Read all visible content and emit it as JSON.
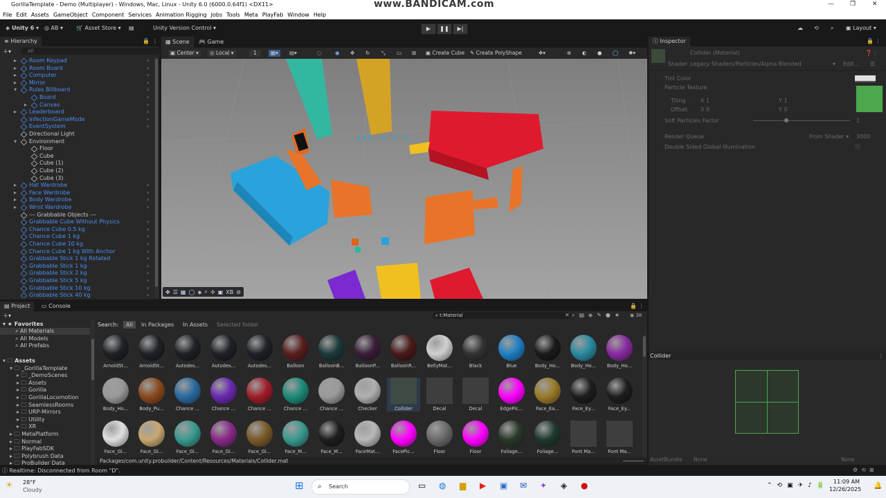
{
  "window": {
    "title": "GorillaTemplate - Demo (Multiplayer) - Windows, Mac, Linux - Unity 6.0 (6000.0.64f1) <DX11>",
    "watermark": "www.BANDICAM.com"
  },
  "menu": [
    "File",
    "Edit",
    "Assets",
    "GameObject",
    "Component",
    "Services",
    "Animation Rigging",
    "Jobs",
    "Tools",
    "Meta",
    "PlayFab",
    "Window",
    "Help"
  ],
  "toolbar": {
    "unity": "Unity 6",
    "account": "AB",
    "asset_store": "Asset Store",
    "version_control": "Unity Version Control",
    "layout": "Layout"
  },
  "hierarchy": {
    "tab": "Hierarchy",
    "search_placeholder": "All",
    "items": [
      {
        "label": "Room Keypad",
        "depth": 1,
        "color": "#4c8ef0"
      },
      {
        "label": "Room Board",
        "depth": 1,
        "color": "#4c8ef0"
      },
      {
        "label": "Computer",
        "depth": 1,
        "color": "#4c8ef0"
      },
      {
        "label": "Mirror",
        "depth": 1,
        "color": "#4c8ef0"
      },
      {
        "label": "Rules Billboard",
        "depth": 1,
        "color": "#4c8ef0"
      },
      {
        "label": "Board",
        "depth": 2,
        "color": "#4c8ef0"
      },
      {
        "label": "Canvas",
        "depth": 2,
        "color": "#4c8ef0"
      },
      {
        "label": "Leaderboard",
        "depth": 1,
        "color": "#4c8ef0"
      },
      {
        "label": "InfectionGameMode",
        "depth": 1,
        "color": "#4c8ef0"
      },
      {
        "label": "EventSystem",
        "depth": 1,
        "color": "#4c8ef0"
      },
      {
        "label": "Directional Light",
        "depth": 1,
        "color": "#c8c8c8"
      },
      {
        "label": "Environment",
        "depth": 1,
        "color": "#c8c8c8"
      },
      {
        "label": "Floor",
        "depth": 2,
        "color": "#c8c8c8"
      },
      {
        "label": "Cube",
        "depth": 2,
        "color": "#c8c8c8"
      },
      {
        "label": "Cube (1)",
        "depth": 2,
        "color": "#c8c8c8"
      },
      {
        "label": "Cube (2)",
        "depth": 2,
        "color": "#c8c8c8"
      },
      {
        "label": "Cube (3)",
        "depth": 2,
        "color": "#c8c8c8"
      },
      {
        "label": "Hat Wardrobe",
        "depth": 1,
        "color": "#4c8ef0"
      },
      {
        "label": "Face Wardrobe",
        "depth": 1,
        "color": "#4c8ef0"
      },
      {
        "label": "Body Wardrobe",
        "depth": 1,
        "color": "#4c8ef0"
      },
      {
        "label": "Wrist Wardrobe",
        "depth": 1,
        "color": "#4c8ef0"
      },
      {
        "label": "--- Grabbable Objects ---",
        "depth": 1,
        "color": "#c8c8c8"
      },
      {
        "label": "Grabbable Cube Without Physics",
        "depth": 1,
        "color": "#4c8ef0"
      },
      {
        "label": "Chance Cube 0.5 kg",
        "depth": 1,
        "color": "#4c8ef0"
      },
      {
        "label": "Chance Cube 1 kg",
        "depth": 1,
        "color": "#4c8ef0"
      },
      {
        "label": "Chance Cube 10 kg",
        "depth": 1,
        "color": "#4c8ef0"
      },
      {
        "label": "Chance Cube 1 kg With Anchor",
        "depth": 1,
        "color": "#4c8ef0"
      },
      {
        "label": "Grabbable Stick 1 kg Rotated",
        "depth": 1,
        "color": "#4c8ef0"
      },
      {
        "label": "Grabbable Stick 1 kg",
        "depth": 1,
        "color": "#4c8ef0"
      },
      {
        "label": "Grabbable Stick 2 kg",
        "depth": 1,
        "color": "#4c8ef0"
      },
      {
        "label": "Grabbable Stick 5 kg",
        "depth": 1,
        "color": "#4c8ef0"
      },
      {
        "label": "Grabbable Stick 10 kg",
        "depth": 1,
        "color": "#4c8ef0"
      },
      {
        "label": "Grabbable Stick 40 kg",
        "depth": 1,
        "color": "#4c8ef0"
      }
    ]
  },
  "scene": {
    "tabs": [
      "Scene",
      "Game"
    ],
    "pivot": "Center",
    "space": "Local",
    "grid_value": "1",
    "create_cube": "Create Cube",
    "create_poly": "Create PolyShape",
    "bottom_label": "XB"
  },
  "project": {
    "tabs": [
      "Project",
      "Console"
    ],
    "search_label": "Search:",
    "filters": [
      "All",
      "In Packages",
      "In Assets",
      "Selected folder"
    ],
    "search_value": "t:Material",
    "count": "38",
    "favorites": {
      "title": "Favorites",
      "items": [
        "All Materials",
        "All Models",
        "All Prefabs"
      ]
    },
    "assets_tree": [
      "Assets",
      "_GorillaTemplate",
      "_DemoScenes",
      "Assets",
      "Gorilla",
      "GorillaLocomotion",
      "SeamlessRooms",
      "URP-Mirrors",
      "Utility",
      "XR",
      "MetaPlatform",
      "Normal",
      "PlayFabSDK",
      "Polybrush Data",
      "ProBuilder Data"
    ],
    "path": "Packages/com.unity.probuilder/Content/Resources/Materials/Collider.mat",
    "materials": [
      {
        "label": "ArnoldSt...",
        "color": "#1e2226",
        "type": "ball"
      },
      {
        "label": "ArnoldSt...",
        "color": "#1e2226",
        "type": "ball"
      },
      {
        "label": "Autodes...",
        "color": "#1e2226",
        "type": "ball"
      },
      {
        "label": "Autodes...",
        "color": "#1e2226",
        "type": "ball"
      },
      {
        "label": "Autodes...",
        "color": "#1e2226",
        "type": "ball"
      },
      {
        "label": "Balloon",
        "color": "#5a1e1e",
        "type": "ball"
      },
      {
        "label": "BalloonB...",
        "color": "#1e3a3a",
        "type": "ball"
      },
      {
        "label": "BalloonP...",
        "color": "#3a1e3a",
        "type": "ball"
      },
      {
        "label": "BalloonR...",
        "color": "#4a1a1a",
        "type": "ball"
      },
      {
        "label": "BellyMat...",
        "color": "#d0d0d0",
        "type": "ball"
      },
      {
        "label": "Black",
        "color": "#333333",
        "type": "ball"
      },
      {
        "label": "Blue",
        "color": "#1f7fc4",
        "type": "ball"
      },
      {
        "label": "Body_Ho...",
        "color": "#1b1b1b",
        "type": "ball"
      },
      {
        "label": "Body_Ho...",
        "color": "#2a8aa0",
        "type": "ball"
      },
      {
        "label": "Body_Ho...",
        "color": "#8a2aa0",
        "type": "ball"
      },
      {
        "label": "Body_Ho...",
        "color": "#9a9a9a",
        "type": "ball"
      },
      {
        "label": "Body_Pu...",
        "color": "#8a4a1e",
        "type": "ball"
      },
      {
        "label": "Chance ...",
        "color": "#2a6aa0",
        "type": "ball"
      },
      {
        "label": "Chance ...",
        "color": "#6a2ab0",
        "type": "ball"
      },
      {
        "label": "Chance ...",
        "color": "#a01e2a",
        "type": "ball"
      },
      {
        "label": "Chance ...",
        "color": "#1e8a7a",
        "type": "ball"
      },
      {
        "label": "Chance ...",
        "color": "#9a9a9a",
        "type": "ball"
      },
      {
        "label": "Checker",
        "color": "#b0b0b0",
        "type": "ball"
      },
      {
        "label": "Collider",
        "color": "#3e4a44",
        "type": "sq"
      },
      {
        "label": "Decal",
        "color": "#3e3e3e",
        "type": "sq"
      },
      {
        "label": "Decal",
        "color": "#3e3e3e",
        "type": "sq"
      },
      {
        "label": "EdgePic...",
        "color": "#ff00ff",
        "type": "ball"
      },
      {
        "label": "Face_Ea...",
        "color": "#9a7a2a",
        "type": "ball"
      },
      {
        "label": "Face_Ey...",
        "color": "#1e1e1e",
        "type": "ball"
      },
      {
        "label": "Face_Ey...",
        "color": "#1e1e1e",
        "type": "ball"
      },
      {
        "label": "Face_Gl...",
        "color": "#e0e0e0",
        "type": "ball"
      },
      {
        "label": "Face_Gl...",
        "color": "#c8a870",
        "type": "ball"
      },
      {
        "label": "Face_Gl...",
        "color": "#3a9a90",
        "type": "ball"
      },
      {
        "label": "Face_Gl...",
        "color": "#8a2a8a",
        "type": "ball"
      },
      {
        "label": "Face_Gl...",
        "color": "#7a5a2a",
        "type": "ball"
      },
      {
        "label": "Face_M...",
        "color": "#3a9a90",
        "type": "ball"
      },
      {
        "label": "Face_M...",
        "color": "#1e1e1e",
        "type": "ball"
      },
      {
        "label": "FaceMat...",
        "color": "#b8b8b8",
        "type": "ball"
      },
      {
        "label": "FacePic...",
        "color": "#ff00ff",
        "type": "ball"
      },
      {
        "label": "Floor",
        "color": "#6a6a6a",
        "type": "ball"
      },
      {
        "label": "Floor",
        "color": "#ff00ff",
        "type": "ball"
      },
      {
        "label": "Foliage...",
        "color": "#2a3a2a",
        "type": "ball"
      },
      {
        "label": "Foliage...",
        "color": "#1e3a2e",
        "type": "ball"
      },
      {
        "label": "Font Ma...",
        "color": "#3e3e3e",
        "type": "sq"
      },
      {
        "label": "Font Ma...",
        "color": "#3e3e3e",
        "type": "sq"
      }
    ]
  },
  "inspector": {
    "tab": "Inspector",
    "title": "Collider (Material)",
    "shader_label": "Shader",
    "shader_value": "Legacy Shaders/Particles/Alpha Blended",
    "edit": "Edit...",
    "tint": "Tint Color",
    "texture": "Particle Texture",
    "tiling": "Tiling",
    "offset": "Offset",
    "tiling_x": "1",
    "tiling_y": "1",
    "offset_x": "0",
    "offset_y": "0",
    "soft": "Soft Particles Factor",
    "soft_value": "1",
    "rq": "Render Queue",
    "rq_mode": "From Shader",
    "rq_value": "3000",
    "dsgi": "Double Sided Global Illumination",
    "preview_title": "Collider",
    "assetbundle": "AssetBundle",
    "ab_value": "None",
    "ab_variant": "None",
    "accent": "#4ca84c"
  },
  "status": {
    "text": "Realtime: Disconnected from Room \"D\"."
  },
  "taskbar": {
    "temp": "28°F",
    "weather": "Cloudy",
    "search": "Search",
    "time": "11:09 AM",
    "date": "12/26/2025"
  }
}
